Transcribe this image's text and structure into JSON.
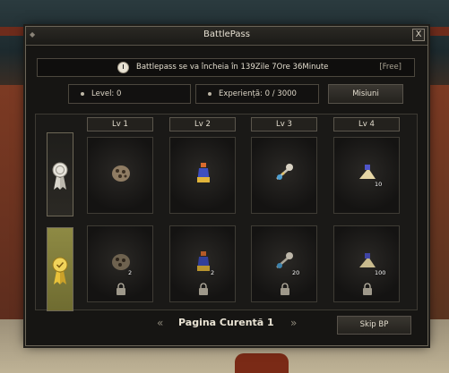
{
  "window": {
    "title": "BattlePass",
    "close_label": "X"
  },
  "timer": {
    "text": "Battlepass se va încheia în 139Zile 7Ore 36Minute",
    "tag": "[Free]"
  },
  "stats": {
    "level": "Level: 0",
    "experience": "Experiență: 0 / 3000"
  },
  "buttons": {
    "misiuni": "Misiuni",
    "skip": "Skip BP"
  },
  "levels": [
    "Lv 1",
    "Lv 2",
    "Lv 3",
    "Lv 4"
  ],
  "free_row": [
    {
      "icon": "beast-pelt-icon",
      "count": ""
    },
    {
      "icon": "potion-bottle-icon",
      "count": ""
    },
    {
      "icon": "gem-necklace-icon",
      "count": ""
    },
    {
      "icon": "scroll-book-icon",
      "count": "10"
    }
  ],
  "premium_row": [
    {
      "icon": "beast-pelt-icon",
      "count": "2"
    },
    {
      "icon": "potion-bottle-icon",
      "count": "2"
    },
    {
      "icon": "gem-necklace-icon",
      "count": "20"
    },
    {
      "icon": "scroll-book-icon",
      "count": "100"
    }
  ],
  "pagination": {
    "label": "Pagina Curentă 1",
    "prev": "«",
    "next": "»"
  },
  "colors": {
    "premium_track": "#8e8a44",
    "window_bg": "#161513",
    "border": "#6b6558"
  }
}
